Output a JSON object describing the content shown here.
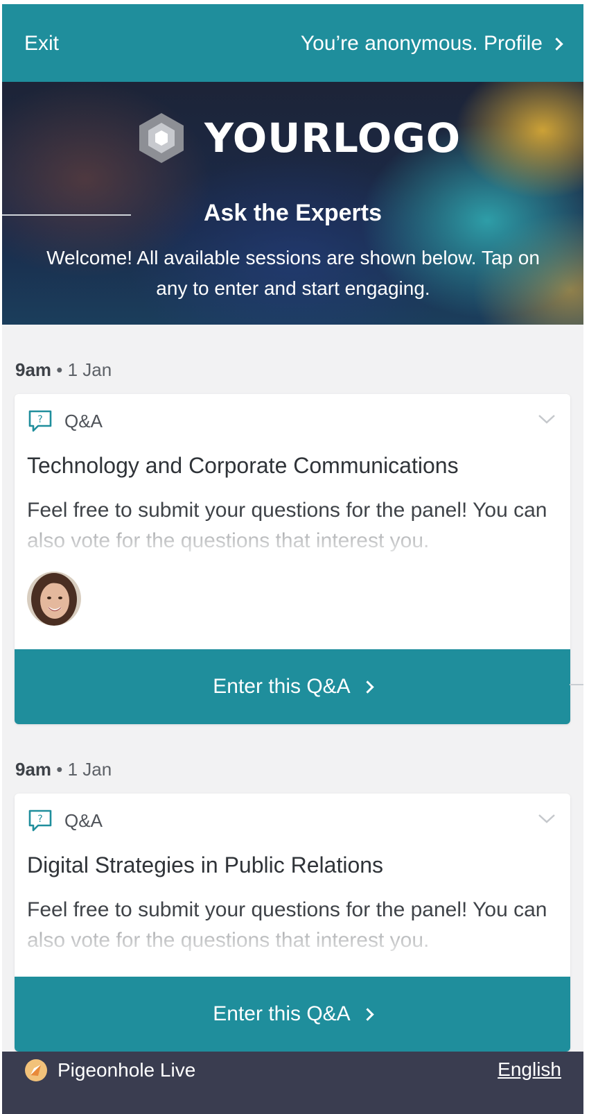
{
  "topbar": {
    "exit_label": "Exit",
    "profile_label": "You’re anonymous. Profile"
  },
  "hero": {
    "logo_text": "YOURLOGO",
    "title": "Ask the Experts",
    "description": "Welcome! All available sessions are shown below. Tap on any to enter and start engaging."
  },
  "sessions": [
    {
      "time": "9am",
      "date": "• 1 Jan",
      "type": "Q&A",
      "title": "Technology and Corporate Communications",
      "description": "Feel free to submit your questions for the panel! You can also vote for the questions that interest you.",
      "button_label": "Enter this Q&A",
      "has_avatar": true
    },
    {
      "time": "9am",
      "date": "• 1 Jan",
      "type": "Q&A",
      "title": "Digital Strategies in Public Relations",
      "description": "Feel free to submit your questions for the panel! You can also vote for the questions that interest you.",
      "button_label": "Enter this Q&A",
      "has_avatar": false
    }
  ],
  "footer": {
    "brand": "Pigeonhole Live",
    "language": "English"
  },
  "colors": {
    "accent": "#1f8e9c",
    "footer_bg": "#3a3d50",
    "page_bg": "#f2f2f3"
  },
  "icons": {
    "exit": "exit-link",
    "profile": "chevron-right-icon",
    "card_type": "question-bubble-icon",
    "card_toggle": "chevron-down-icon",
    "brand": "pigeonhole-logo-icon"
  }
}
